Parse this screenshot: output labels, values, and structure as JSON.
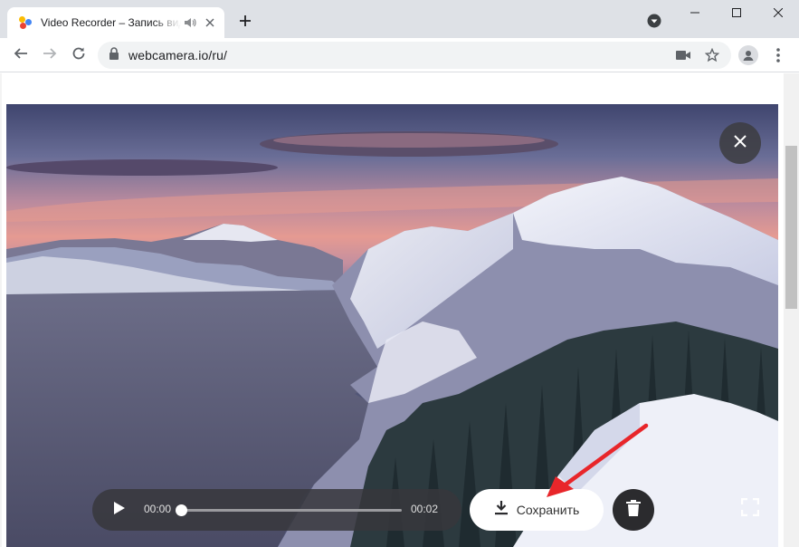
{
  "browser": {
    "tab": {
      "title": "Video Recorder – Запись видео",
      "favicon_icon": "webcamera-favicon",
      "audio_icon": "speaker-icon",
      "close_icon": "close-icon"
    },
    "new_tab_icon": "plus-icon",
    "tab_search_icon": "chevron-down-icon",
    "window_controls": [
      "minimize-icon",
      "maximize-icon",
      "close-icon"
    ],
    "address": {
      "url": "webcamera.io/ru/",
      "lock_icon": "lock-icon"
    },
    "toolbar_icons": [
      "back-icon",
      "forward-icon",
      "reload-icon",
      "camera-icon",
      "star-icon",
      "profile-icon",
      "kebab-menu-icon"
    ]
  },
  "player": {
    "current_time": "00:00",
    "duration": "00:02",
    "progress": 0,
    "play_icon": "play-icon",
    "save_label": "Сохранить",
    "download_icon": "download-icon",
    "delete_icon": "trash-icon",
    "fullscreen_icon": "fullscreen-icon",
    "close_icon": "close-icon"
  },
  "annotation": {
    "arrow_color": "#e8262a"
  },
  "colors": {
    "tabbar_bg": "#dee1e6",
    "omnibox_bg": "#f1f3f4",
    "player_bg": "#37373c",
    "accent_red": "#e8262a"
  }
}
